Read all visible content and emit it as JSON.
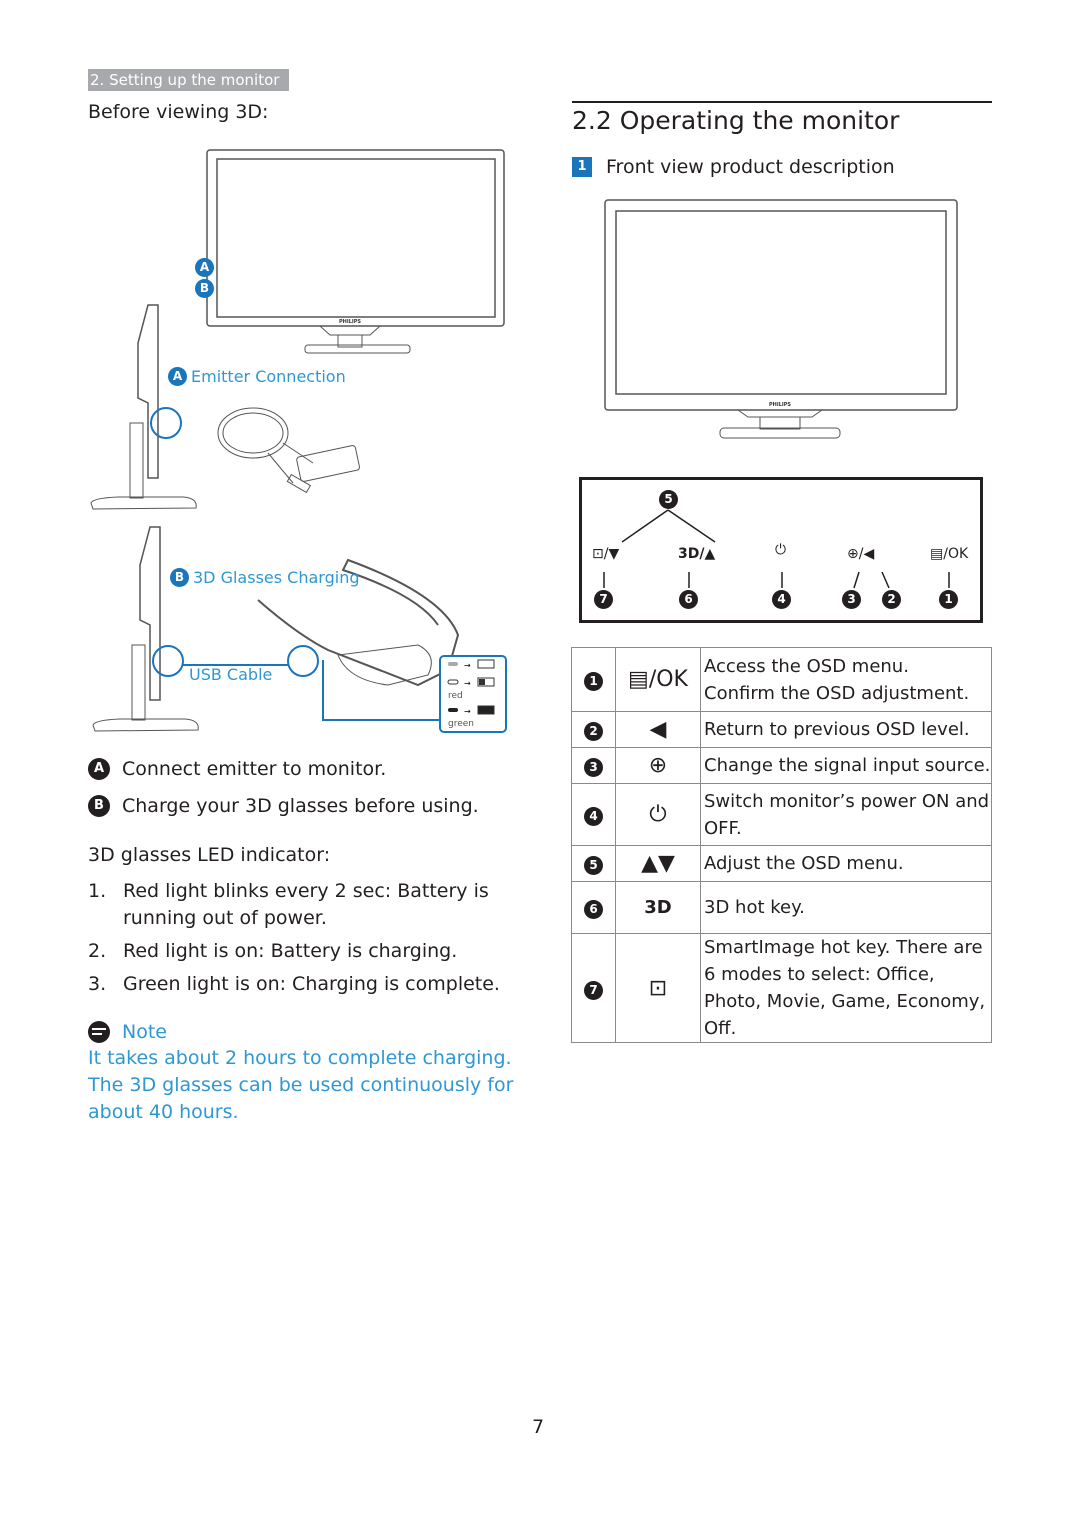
{
  "header": {
    "section_tab": "2. Setting up the monitor"
  },
  "left": {
    "title": "Before viewing 3D:",
    "monitor_brand": "PHILIPS",
    "callouts": [
      {
        "badge": "A"
      },
      {
        "badge": "B"
      }
    ],
    "emitter": {
      "badge": "A",
      "label": "Emitter Connection"
    },
    "glasses": {
      "badge": "B",
      "label": "3D Glasses Charging",
      "cable_label": "USB Cable"
    },
    "led_legend": [
      {
        "state": "blinking",
        "color_label": "",
        "battery": "empty"
      },
      {
        "state": "on",
        "color_label": "red",
        "battery": "charging"
      },
      {
        "state": "on",
        "color_label": "green",
        "battery": "full"
      }
    ],
    "steps": [
      {
        "badge": "A",
        "text": "Connect emitter to monitor."
      },
      {
        "badge": "B",
        "text": "Charge your 3D glasses before using."
      }
    ],
    "led_heading": "3D glasses LED indicator:",
    "led_items": [
      {
        "num": "1.",
        "text": "Red light blinks every 2 sec: Battery is running out of power."
      },
      {
        "num": "2.",
        "text": "Red light is on: Battery is charging."
      },
      {
        "num": "3.",
        "text": "Green light is on: Charging is complete."
      }
    ],
    "note": {
      "icon": "note-icon",
      "label": "Note",
      "text": "It takes about 2 hours to complete charging. The 3D glasses can be used continuously for about 40 hours."
    }
  },
  "right": {
    "section_title": "2.2  Operating the monitor",
    "sub_badge": "1",
    "sub_title": "Front view product description",
    "monitor_brand": "PHILIPS",
    "panel": {
      "top_badge": "5",
      "buttons": [
        {
          "icon": "smartimage-icon",
          "label": "/▼",
          "num": "7"
        },
        {
          "icon": "3d-icon",
          "label": "3D/▲",
          "num": "6"
        },
        {
          "icon": "power-icon",
          "label": "",
          "num": "4"
        },
        {
          "icon": "input-icon",
          "label": "/◀",
          "num": "3,2"
        },
        {
          "icon": "menu-icon",
          "label": "/OK",
          "num": "1"
        }
      ],
      "numbers": [
        "7",
        "6",
        "4",
        "3",
        "2",
        "1"
      ]
    },
    "table": [
      {
        "num": "1",
        "icon": "menu-icon",
        "key": "/OK",
        "desc": "Access the OSD menu.\nConfirm the OSD adjustment."
      },
      {
        "num": "2",
        "icon": "left-triangle-icon",
        "key": "◀",
        "desc": "Return to previous OSD level."
      },
      {
        "num": "3",
        "icon": "input-icon",
        "key": "",
        "desc": "Change the signal input source."
      },
      {
        "num": "4",
        "icon": "power-icon",
        "key": "",
        "desc": "Switch monitor’s power ON and OFF."
      },
      {
        "num": "5",
        "icon": "up-down-icon",
        "key": "▲▼",
        "desc": "Adjust the OSD menu."
      },
      {
        "num": "6",
        "icon": "3d-icon",
        "key": "3D",
        "desc": "3D hot key."
      },
      {
        "num": "7",
        "icon": "smartimage-icon",
        "key": "",
        "desc": "SmartImage hot key. There are 6 modes to select: Office, Photo, Movie, Game, Economy, Off."
      }
    ]
  },
  "footer": {
    "page_number": "7"
  }
}
